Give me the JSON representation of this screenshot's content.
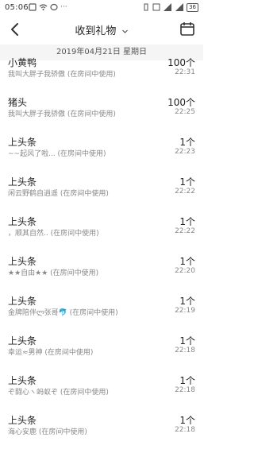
{
  "status": {
    "time": "05:06",
    "battery": "36"
  },
  "header": {
    "title": "收到礼物",
    "back_icon": "back-arrow-icon",
    "calendar_icon": "calendar-icon"
  },
  "date": "2019年04月21日 星期日",
  "items": [
    {
      "name": "小黄鸭",
      "sub": "我叫大胖子我骄傲 (在房间中使用)",
      "qty": "100个",
      "time": "22:31"
    },
    {
      "name": "猪头",
      "sub": "我叫大胖子我骄傲 (在房间中使用)",
      "qty": "100个",
      "time": "22:25"
    },
    {
      "name": "上头条",
      "sub": "~~起风了啦... (在房间中使用)",
      "qty": "1个",
      "time": "22:23"
    },
    {
      "name": "上头条",
      "sub": "闲云野鹤自逍遥 (在房间中使用)",
      "qty": "1个",
      "time": "22:22"
    },
    {
      "name": "上头条",
      "sub": "，顺其自然.. (在房间中使用)",
      "qty": "1个",
      "time": "22:22"
    },
    {
      "name": "上头条",
      "sub": "★★自由★★ (在房间中使用)",
      "qty": "1个",
      "time": "22:20"
    },
    {
      "name": "上头条",
      "sub": "金牌陪伴ლ张哥🐬 (在房间中使用)",
      "qty": "1个",
      "time": "22:19"
    },
    {
      "name": "上头条",
      "sub": "幸运≈男神 (在房间中使用)",
      "qty": "1个",
      "time": "22:18"
    },
    {
      "name": "上头条",
      "sub": "ぞ闘心ヽ蚂蚁ぞ (在房间中使用)",
      "qty": "1个",
      "time": "22:18"
    },
    {
      "name": "上头条",
      "sub": "海心安鹿 (在房间中使用)",
      "qty": "1个",
      "time": "22:18"
    }
  ]
}
